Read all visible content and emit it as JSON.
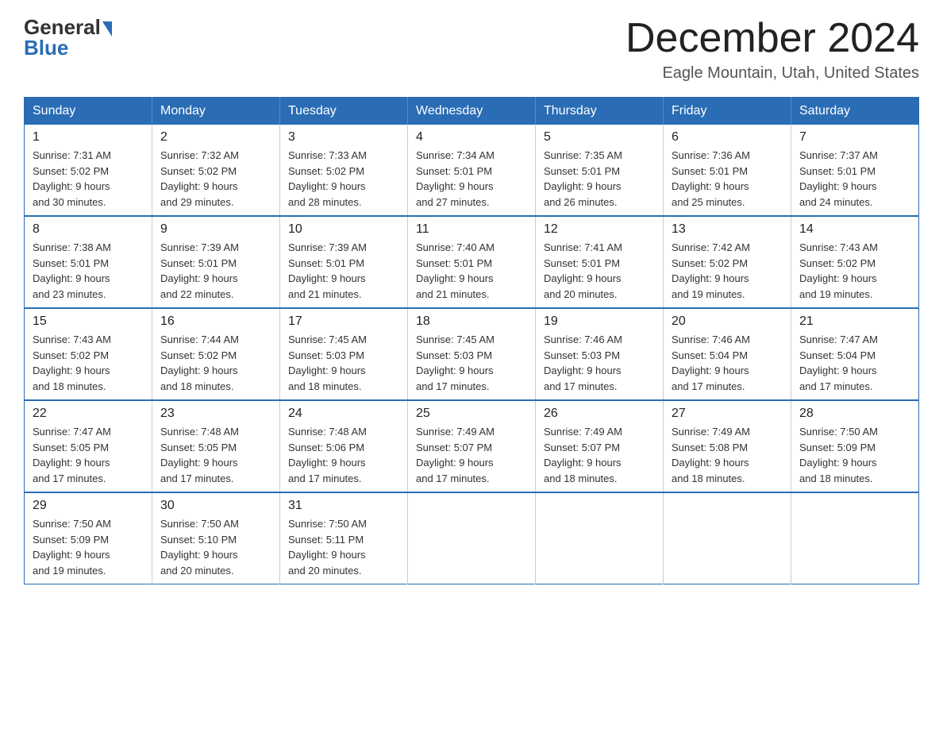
{
  "header": {
    "logo_general": "General",
    "logo_blue": "Blue",
    "month_title": "December 2024",
    "location": "Eagle Mountain, Utah, United States"
  },
  "days_of_week": [
    "Sunday",
    "Monday",
    "Tuesday",
    "Wednesday",
    "Thursday",
    "Friday",
    "Saturday"
  ],
  "weeks": [
    [
      {
        "day": "1",
        "sunrise": "7:31 AM",
        "sunset": "5:02 PM",
        "daylight": "9 hours and 30 minutes."
      },
      {
        "day": "2",
        "sunrise": "7:32 AM",
        "sunset": "5:02 PM",
        "daylight": "9 hours and 29 minutes."
      },
      {
        "day": "3",
        "sunrise": "7:33 AM",
        "sunset": "5:02 PM",
        "daylight": "9 hours and 28 minutes."
      },
      {
        "day": "4",
        "sunrise": "7:34 AM",
        "sunset": "5:01 PM",
        "daylight": "9 hours and 27 minutes."
      },
      {
        "day": "5",
        "sunrise": "7:35 AM",
        "sunset": "5:01 PM",
        "daylight": "9 hours and 26 minutes."
      },
      {
        "day": "6",
        "sunrise": "7:36 AM",
        "sunset": "5:01 PM",
        "daylight": "9 hours and 25 minutes."
      },
      {
        "day": "7",
        "sunrise": "7:37 AM",
        "sunset": "5:01 PM",
        "daylight": "9 hours and 24 minutes."
      }
    ],
    [
      {
        "day": "8",
        "sunrise": "7:38 AM",
        "sunset": "5:01 PM",
        "daylight": "9 hours and 23 minutes."
      },
      {
        "day": "9",
        "sunrise": "7:39 AM",
        "sunset": "5:01 PM",
        "daylight": "9 hours and 22 minutes."
      },
      {
        "day": "10",
        "sunrise": "7:39 AM",
        "sunset": "5:01 PM",
        "daylight": "9 hours and 21 minutes."
      },
      {
        "day": "11",
        "sunrise": "7:40 AM",
        "sunset": "5:01 PM",
        "daylight": "9 hours and 21 minutes."
      },
      {
        "day": "12",
        "sunrise": "7:41 AM",
        "sunset": "5:01 PM",
        "daylight": "9 hours and 20 minutes."
      },
      {
        "day": "13",
        "sunrise": "7:42 AM",
        "sunset": "5:02 PM",
        "daylight": "9 hours and 19 minutes."
      },
      {
        "day": "14",
        "sunrise": "7:43 AM",
        "sunset": "5:02 PM",
        "daylight": "9 hours and 19 minutes."
      }
    ],
    [
      {
        "day": "15",
        "sunrise": "7:43 AM",
        "sunset": "5:02 PM",
        "daylight": "9 hours and 18 minutes."
      },
      {
        "day": "16",
        "sunrise": "7:44 AM",
        "sunset": "5:02 PM",
        "daylight": "9 hours and 18 minutes."
      },
      {
        "day": "17",
        "sunrise": "7:45 AM",
        "sunset": "5:03 PM",
        "daylight": "9 hours and 18 minutes."
      },
      {
        "day": "18",
        "sunrise": "7:45 AM",
        "sunset": "5:03 PM",
        "daylight": "9 hours and 17 minutes."
      },
      {
        "day": "19",
        "sunrise": "7:46 AM",
        "sunset": "5:03 PM",
        "daylight": "9 hours and 17 minutes."
      },
      {
        "day": "20",
        "sunrise": "7:46 AM",
        "sunset": "5:04 PM",
        "daylight": "9 hours and 17 minutes."
      },
      {
        "day": "21",
        "sunrise": "7:47 AM",
        "sunset": "5:04 PM",
        "daylight": "9 hours and 17 minutes."
      }
    ],
    [
      {
        "day": "22",
        "sunrise": "7:47 AM",
        "sunset": "5:05 PM",
        "daylight": "9 hours and 17 minutes."
      },
      {
        "day": "23",
        "sunrise": "7:48 AM",
        "sunset": "5:05 PM",
        "daylight": "9 hours and 17 minutes."
      },
      {
        "day": "24",
        "sunrise": "7:48 AM",
        "sunset": "5:06 PM",
        "daylight": "9 hours and 17 minutes."
      },
      {
        "day": "25",
        "sunrise": "7:49 AM",
        "sunset": "5:07 PM",
        "daylight": "9 hours and 17 minutes."
      },
      {
        "day": "26",
        "sunrise": "7:49 AM",
        "sunset": "5:07 PM",
        "daylight": "9 hours and 18 minutes."
      },
      {
        "day": "27",
        "sunrise": "7:49 AM",
        "sunset": "5:08 PM",
        "daylight": "9 hours and 18 minutes."
      },
      {
        "day": "28",
        "sunrise": "7:50 AM",
        "sunset": "5:09 PM",
        "daylight": "9 hours and 18 minutes."
      }
    ],
    [
      {
        "day": "29",
        "sunrise": "7:50 AM",
        "sunset": "5:09 PM",
        "daylight": "9 hours and 19 minutes."
      },
      {
        "day": "30",
        "sunrise": "7:50 AM",
        "sunset": "5:10 PM",
        "daylight": "9 hours and 20 minutes."
      },
      {
        "day": "31",
        "sunrise": "7:50 AM",
        "sunset": "5:11 PM",
        "daylight": "9 hours and 20 minutes."
      },
      null,
      null,
      null,
      null
    ]
  ],
  "labels": {
    "sunrise": "Sunrise:",
    "sunset": "Sunset:",
    "daylight": "Daylight:"
  }
}
